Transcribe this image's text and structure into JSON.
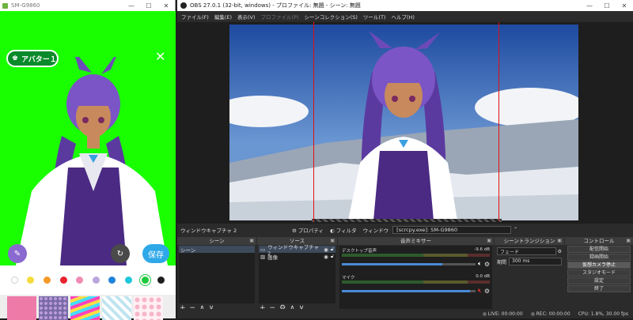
{
  "phone": {
    "title": "SM-G9860",
    "window_buttons": [
      "—",
      "☐",
      "✕"
    ],
    "avatar_label": "アバター１",
    "save_label": "保存",
    "palette_colors": [
      "#ffffff",
      "#f5dc3c",
      "#f59a28",
      "#e8232e",
      "#f08cb4",
      "#b9a6dc",
      "#1e82dc",
      "#1ec8dc",
      "#1ec83c",
      "#1e1e1e"
    ],
    "selected_color_index": 8
  },
  "obs": {
    "title": "OBS 27.0.1 (32-bit, windows) - プロファイル: 無題 - シーン: 無題",
    "menu": [
      "ファイル(F)",
      "編集(E)",
      "表示(V)",
      "プロファイル(P)",
      "シーンコレクション(S)",
      "ツール(T)",
      "ヘルプ(H)"
    ],
    "source_bar": {
      "selected_source": "ウィンドウキャプチャ 2",
      "properties": "プロパティ",
      "filters": "フィルタ",
      "window_label": "ウィンドウ",
      "window_value": "[scrcpy.exe]: SM-G9860"
    },
    "docks": {
      "scenes": {
        "title": "シーン",
        "items": [
          "シーン"
        ]
      },
      "sources": {
        "title": "ソース",
        "items": [
          "ウィンドウキャプチャ 2",
          "画像"
        ]
      },
      "mixer": {
        "title": "音声ミキサー",
        "tracks": [
          {
            "name": "デスクトップ音声",
            "db": "-9.6 dB",
            "volume": 0.75
          },
          {
            "name": "マイク",
            "db": "0.0 dB",
            "volume": 0.96
          }
        ]
      },
      "transitions": {
        "title": "シーントランジション",
        "type": "フェード",
        "duration_label": "期間",
        "duration_value": "300 ms"
      },
      "controls": {
        "title": "コントロール",
        "buttons": [
          "配信開始",
          "録画開始",
          "仮想カメラ停止",
          "スタジオモード",
          "設定",
          "終了"
        ]
      }
    },
    "status": {
      "live": "LIVE: 00:00:00",
      "rec": "REC: 00:00:00",
      "cpu": "CPU: 1.8%, 30.00 fps"
    }
  }
}
